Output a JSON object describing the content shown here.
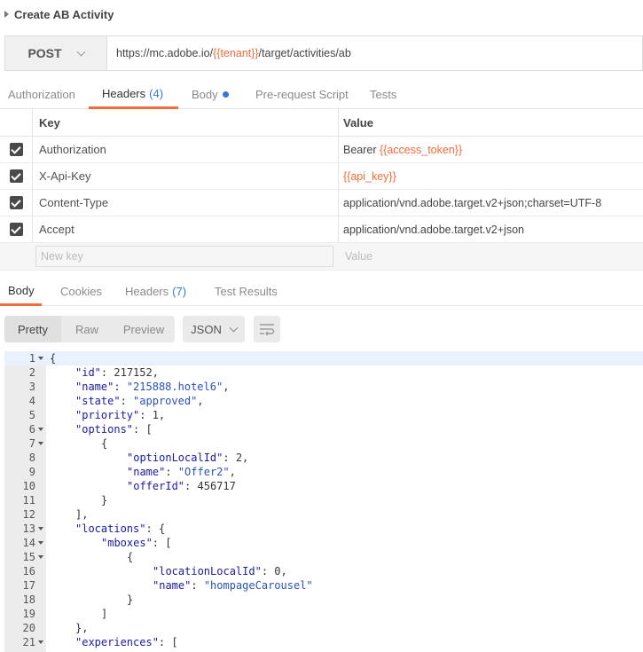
{
  "request": {
    "title": "Create AB Activity",
    "method": "POST",
    "url_prefix": "https://mc.adobe.io/",
    "url_var": "{{tenant}}",
    "url_suffix": "/target/activities/ab"
  },
  "request_tabs": {
    "authorization": "Authorization",
    "headers": "Headers",
    "headers_count": "(4)",
    "body": "Body",
    "prerequest": "Pre-request Script",
    "tests": "Tests"
  },
  "headers_table": {
    "key_header": "Key",
    "value_header": "Value",
    "rows": [
      {
        "key": "Authorization",
        "value_text": "Bearer ",
        "value_var": "{{access_token}}"
      },
      {
        "key": "X-Api-Key",
        "value_text": "",
        "value_var": "{{api_key}}"
      },
      {
        "key": "Content-Type",
        "value_text": "application/vnd.adobe.target.v2+json;charset=UTF-8",
        "value_var": ""
      },
      {
        "key": "Accept",
        "value_text": "application/vnd.adobe.target.v2+json",
        "value_var": ""
      }
    ],
    "new_key_placeholder": "New key",
    "new_value_placeholder": "Value"
  },
  "response_tabs": {
    "body": "Body",
    "cookies": "Cookies",
    "headers": "Headers",
    "headers_count": "(7)",
    "test_results": "Test Results"
  },
  "view_modes": {
    "pretty": "Pretty",
    "raw": "Raw",
    "preview": "Preview",
    "format": "JSON"
  },
  "code_lines": [
    {
      "n": "1",
      "fold": true,
      "indent": 0,
      "text": "{"
    },
    {
      "n": "2",
      "fold": false,
      "indent": 1,
      "text": "\"id\": 217152,"
    },
    {
      "n": "3",
      "fold": false,
      "indent": 1,
      "text": "\"name\": \"215888.hotel6\","
    },
    {
      "n": "4",
      "fold": false,
      "indent": 1,
      "text": "\"state\": \"approved\","
    },
    {
      "n": "5",
      "fold": false,
      "indent": 1,
      "text": "\"priority\": 1,"
    },
    {
      "n": "6",
      "fold": true,
      "indent": 1,
      "text": "\"options\": ["
    },
    {
      "n": "7",
      "fold": true,
      "indent": 2,
      "text": "{"
    },
    {
      "n": "8",
      "fold": false,
      "indent": 3,
      "text": "\"optionLocalId\": 2,"
    },
    {
      "n": "9",
      "fold": false,
      "indent": 3,
      "text": "\"name\": \"Offer2\","
    },
    {
      "n": "10",
      "fold": false,
      "indent": 3,
      "text": "\"offerId\": 456717"
    },
    {
      "n": "11",
      "fold": false,
      "indent": 2,
      "text": "}"
    },
    {
      "n": "12",
      "fold": false,
      "indent": 1,
      "text": "],"
    },
    {
      "n": "13",
      "fold": true,
      "indent": 1,
      "text": "\"locations\": {"
    },
    {
      "n": "14",
      "fold": true,
      "indent": 2,
      "text": "\"mboxes\": ["
    },
    {
      "n": "15",
      "fold": true,
      "indent": 3,
      "text": "{"
    },
    {
      "n": "16",
      "fold": false,
      "indent": 4,
      "text": "\"locationLocalId\": 0,"
    },
    {
      "n": "17",
      "fold": false,
      "indent": 4,
      "text": "\"name\": \"hompageCarousel\""
    },
    {
      "n": "18",
      "fold": false,
      "indent": 3,
      "text": "}"
    },
    {
      "n": "19",
      "fold": false,
      "indent": 2,
      "text": "]"
    },
    {
      "n": "20",
      "fold": false,
      "indent": 1,
      "text": "},"
    },
    {
      "n": "21",
      "fold": true,
      "indent": 1,
      "text": "\"experiences\": ["
    }
  ]
}
